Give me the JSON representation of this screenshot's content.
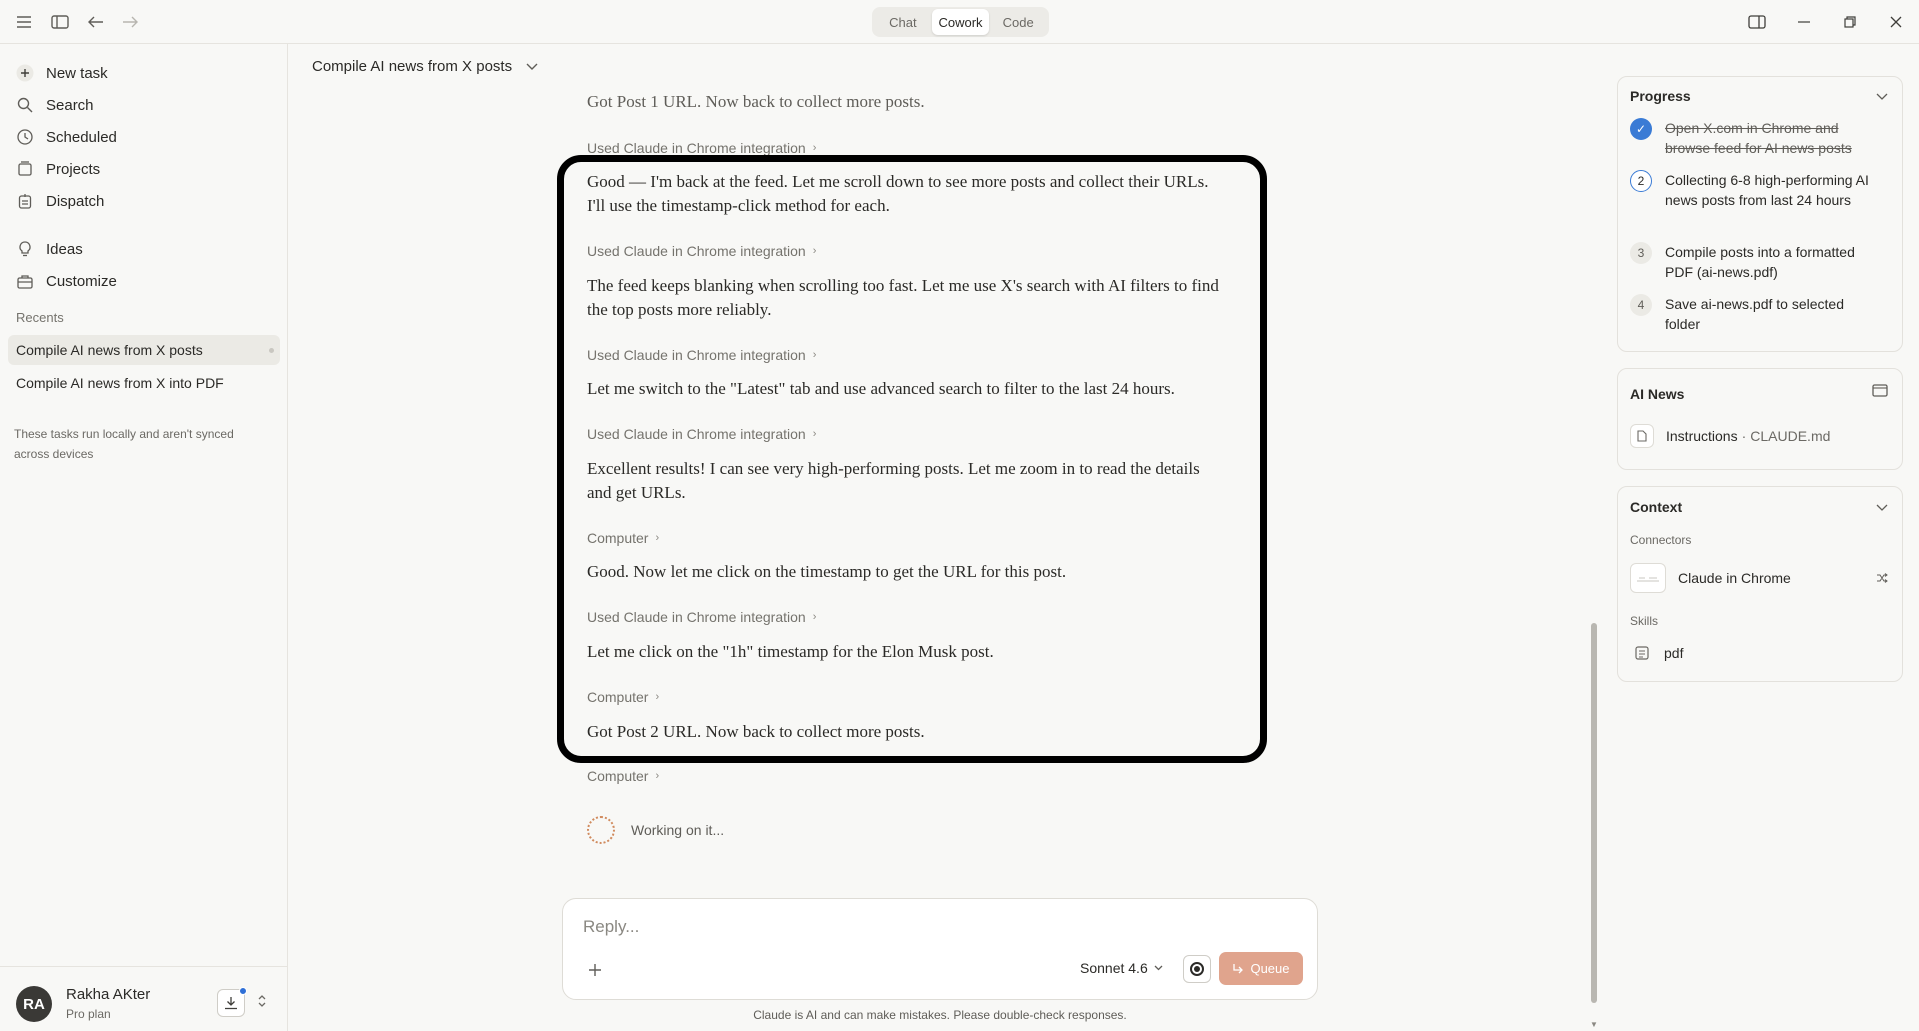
{
  "window": {
    "modes": [
      "Chat",
      "Cowork",
      "Code"
    ],
    "active_mode": "Cowork"
  },
  "sidebar": {
    "items": [
      {
        "label": "New task",
        "icon": "plus-icon"
      },
      {
        "label": "Search",
        "icon": "search-icon"
      },
      {
        "label": "Scheduled",
        "icon": "clock-icon"
      },
      {
        "label": "Projects",
        "icon": "folder-icon"
      },
      {
        "label": "Dispatch",
        "icon": "dispatch-icon"
      },
      {
        "label": "Ideas",
        "icon": "lightbulb-icon"
      },
      {
        "label": "Customize",
        "icon": "briefcase-icon"
      }
    ],
    "recents_label": "Recents",
    "recents": [
      {
        "label": "Compile AI news from X posts"
      },
      {
        "label": "Compile AI news from X into PDF"
      }
    ],
    "note": "These tasks run locally and aren't synced across devices",
    "user": {
      "initials": "RA",
      "name": "Rakha AKter",
      "plan": "Pro plan"
    }
  },
  "main": {
    "task_title": "Compile AI news from X posts",
    "messages": [
      {
        "kind": "text",
        "text": "Got Post 1 URL. Now back to collect more posts."
      },
      {
        "kind": "tool",
        "text": "Used Claude in Chrome integration"
      },
      {
        "kind": "text",
        "text": "Good — I'm back at the feed. Let me scroll down to see more posts and collect their URLs."
      },
      {
        "kind": "text",
        "text": "I'll use the timestamp-click method for each."
      },
      {
        "kind": "tool",
        "text": "Used Claude in Chrome integration"
      },
      {
        "kind": "text",
        "text": "The feed keeps blanking when scrolling too fast. Let me use X's search with AI filters to find"
      },
      {
        "kind": "text",
        "text": "the top posts more reliably."
      },
      {
        "kind": "tool",
        "text": "Used Claude in Chrome integration"
      },
      {
        "kind": "text",
        "text": "Let me switch to the \"Latest\" tab and use advanced search to filter to the last 24 hours."
      },
      {
        "kind": "tool",
        "text": "Used Claude in Chrome integration"
      },
      {
        "kind": "text",
        "text": "Excellent results! I can see very high-performing posts. Let me zoom in to read the details"
      },
      {
        "kind": "text",
        "text": "and get URLs."
      },
      {
        "kind": "tool",
        "text": "Computer"
      },
      {
        "kind": "text",
        "text": "Good. Now let me click on the timestamp to get the URL for this post."
      },
      {
        "kind": "tool",
        "text": "Used Claude in Chrome integration"
      },
      {
        "kind": "text",
        "text": "Let me click on the \"1h\" timestamp for the Elon Musk post."
      },
      {
        "kind": "tool",
        "text": "Computer"
      },
      {
        "kind": "text",
        "text": "Got Post 2 URL. Now back to collect more posts."
      },
      {
        "kind": "tool",
        "text": "Computer"
      }
    ],
    "working_text": "Working on it...",
    "composer": {
      "placeholder": "Reply...",
      "model": "Sonnet 4.6",
      "queue_label": "Queue"
    },
    "disclaimer": "Claude is AI and can make mistakes. Please double-check responses."
  },
  "right_panel": {
    "progress": {
      "title": "Progress",
      "steps": [
        {
          "num": "✓",
          "state": "done",
          "text": "Open X.com in Chrome and browse feed for AI news posts"
        },
        {
          "num": "2",
          "state": "current",
          "text": "Collecting 6-8 high-performing AI news posts from last 24 hours"
        },
        {
          "num": "3",
          "state": "pending",
          "text": "Compile posts into a formatted PDF (ai-news.pdf)"
        },
        {
          "num": "4",
          "state": "pending",
          "text": "Save ai-news.pdf to selected folder"
        }
      ]
    },
    "project": {
      "title": "AI News",
      "file_label": "Instructions",
      "file_name": "CLAUDE.md"
    },
    "context": {
      "title": "Context",
      "connectors_label": "Connectors",
      "connector": "Claude in Chrome",
      "skills_label": "Skills",
      "skill": "pdf"
    }
  },
  "colors": {
    "accent_blue": "#3a7bd5",
    "queue_button": "#e0a48d",
    "highlight_border": "#000000"
  }
}
